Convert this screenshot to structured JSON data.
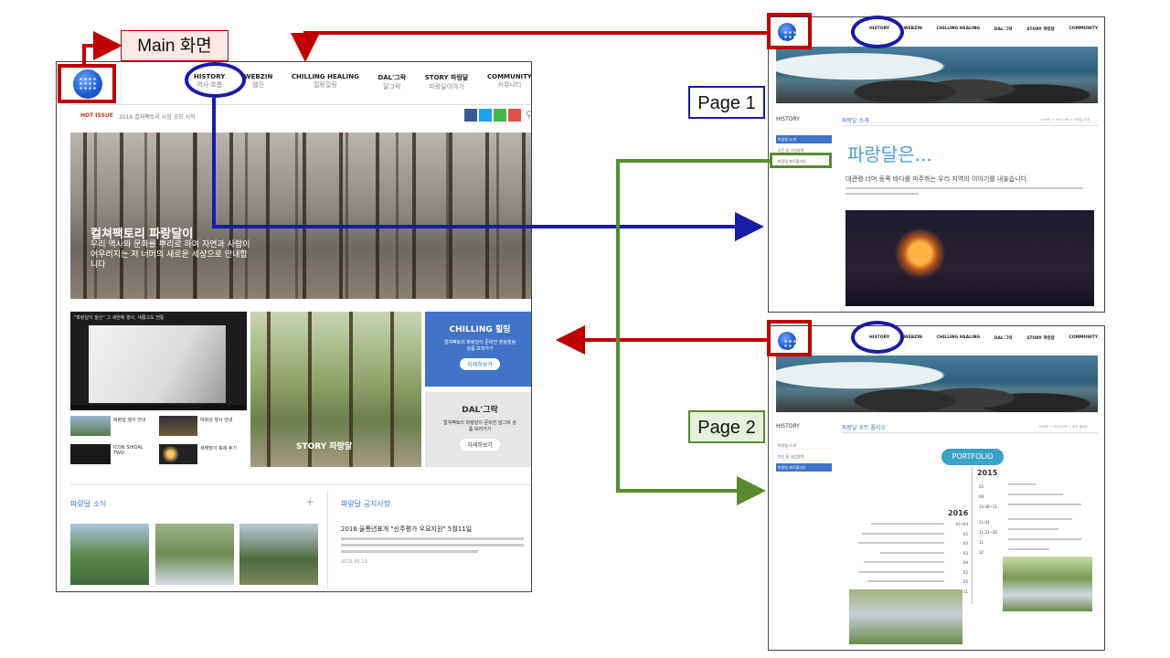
{
  "colors": {
    "red": "#c00000",
    "blue": "#1a1aa8",
    "green": "#5a8a2e",
    "chilling_bg": "#3f74c9"
  },
  "labels": {
    "main": "Main 화면",
    "page1": "Page 1",
    "page2": "Page 2"
  },
  "main_site": {
    "nav": [
      {
        "label": "HISTORY",
        "sub": "역사·흐름"
      },
      {
        "label": "WEBZIN",
        "sub": "웹진"
      },
      {
        "label": "CHILLING HEALING",
        "sub": "힐링힐링"
      },
      {
        "label": "DAL'그락",
        "sub": "달그락"
      },
      {
        "label": "STORY 파랑달",
        "sub": "파랑달이야기"
      },
      {
        "label": "COMMUNITY",
        "sub": "커뮤니티"
      }
    ],
    "hot_issue_label": "HOT ISSUE",
    "hot_issue_text": "2016 컬쳐팩토리 사업 공모 시작",
    "hero_title": "컬쳐팩토리 파랑달이",
    "hero_text": "우리 역사와 문화를 뿌리로 하여 자연과 사람이 어우러지는 저 너머의 새로운 세상으로 안내합니다",
    "video_caption": "\"파랑달이 울산\" 그 세번째 행사, 새롭고도 전통",
    "chilling_title": "CHILLING 힐링",
    "chilling_text": "컬쳐팩토리 파랑달이 준비한 힐링힐링 상품 보러가기",
    "chilling_button": "자세히보기",
    "dal_title": "DAL'그락",
    "dal_text": "컬쳐팩토리 파랑달이 준비한 달그락 상품 보러가기",
    "dal_button": "자세히보기",
    "story_logo": "STORY 파랑달",
    "news_items": [
      {
        "title": "파랑달 행사 안내",
        "date": "2016.5.10"
      },
      {
        "title": "태화강 행사 안내",
        "date": "2016.5.10"
      },
      {
        "title": "ICON SHIDAL TWO",
        "date": "2016.5.10"
      },
      {
        "title": "새해맞이 축제 후기",
        "date": "2016.5.10"
      }
    ],
    "section_news": "파랑달 소식",
    "section_notice": "파랑달 공지사항",
    "notice_title": "2016 울통년표개 \"신주평가 우요지원\" 5월11일",
    "notice_date": "2016.05.13"
  },
  "page1": {
    "nav": [
      "HISTORY",
      "WEBZIN",
      "CHILLING HEALING",
      "DAL'그락",
      "STORY 파랑달",
      "COMMUNITY"
    ],
    "side_title": "HISTORY",
    "side_items": [
      "파랑달 소개",
      "추진 및 사업영역",
      "파랑달 포트폴리오"
    ],
    "content_title": "파랑달 소개",
    "breadcrumb": "HOME > HISTORY > 파랑달 소개",
    "heading": "파랑달은...",
    "lead": "대관령 너머 동쪽 바다를 마주하는 우리 지역의 이야기를 내놓습니다."
  },
  "page2": {
    "nav": [
      "HISTORY",
      "WEBZIN",
      "CHILLING HEALING",
      "DAL'그락",
      "STORY 파랑달",
      "COMMUNITY"
    ],
    "side_title": "HISTORY",
    "side_items": [
      "파랑달 소개",
      "추진 및 사업영역",
      "파랑달 포트폴리오"
    ],
    "content_title": "파랑달 포트 폴리오",
    "breadcrumb": "HOME > HISTORY > 포트 폴리오",
    "portfolio_badge": "PORTFOLIO",
    "year_2015": "2015",
    "year_2016": "2016",
    "items_2015": [
      "05",
      "09",
      "10.08~11",
      "11.04",
      "11.21~26",
      "11",
      "12"
    ],
    "items_2016": [
      "01~04",
      "02",
      "03",
      "03",
      "04",
      "05",
      "05",
      "05~11"
    ]
  }
}
